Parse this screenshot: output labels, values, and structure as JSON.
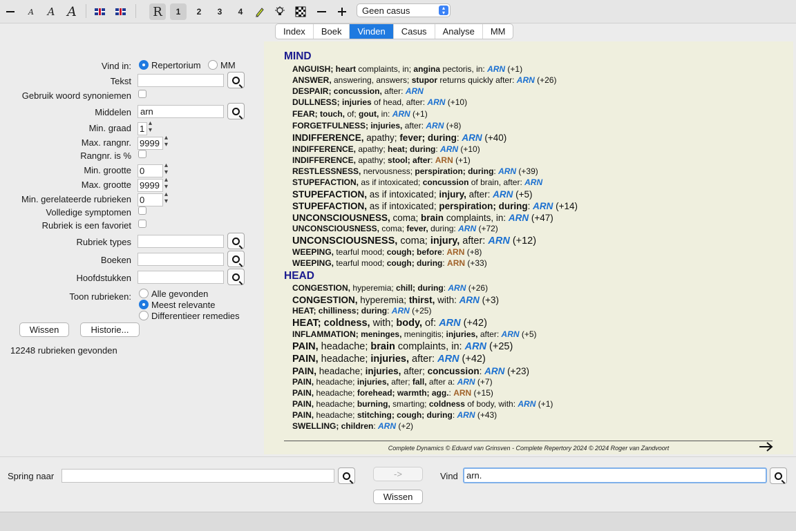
{
  "toolbar": {
    "buttons": [
      {
        "name": "zoom-out-font-icon",
        "glyph": "—"
      },
      {
        "name": "font-small-icon",
        "glyph": "A"
      },
      {
        "name": "font-medium-icon",
        "glyph": "A"
      },
      {
        "name": "font-large-icon",
        "glyph": "A"
      },
      {
        "name": "flag-uk-icon",
        "glyph": ""
      },
      {
        "name": "flag-uk-icon",
        "glyph": ""
      },
      {
        "name": "repertory-icon",
        "glyph": "R"
      },
      {
        "name": "view-1-button",
        "glyph": "1"
      },
      {
        "name": "view-2-button",
        "glyph": "2"
      },
      {
        "name": "view-3-button",
        "glyph": "3"
      },
      {
        "name": "view-4-button",
        "glyph": "4"
      },
      {
        "name": "highlighter-icon",
        "glyph": "✎"
      },
      {
        "name": "lightbulb-icon",
        "glyph": "💡"
      },
      {
        "name": "grid-icon",
        "glyph": "▦"
      },
      {
        "name": "minus-icon",
        "glyph": "−"
      },
      {
        "name": "plus-icon",
        "glyph": "+"
      }
    ],
    "case_select": "Geen casus"
  },
  "tabs": [
    "Index",
    "Boek",
    "Vinden",
    "Casus",
    "Analyse",
    "MM"
  ],
  "active_tab": "Vinden",
  "form": {
    "vind_in_label": "Vind in:",
    "vind_in_options": [
      "Repertorium",
      "MM"
    ],
    "tekst_label": "Tekst",
    "tekst_value": "",
    "synoniemen_label": "Gebruik woord synoniemen",
    "middelen_label": "Middelen",
    "middelen_value": "arn",
    "min_graad_label": "Min. graad",
    "min_graad_value": "1",
    "max_rangnr_label": "Max. rangnr.",
    "max_rangnr_value": "9999",
    "rangnr_pct_label": "Rangnr. is %",
    "min_grootte_label": "Min. grootte",
    "min_grootte_value": "0",
    "max_grootte_label": "Max. grootte",
    "max_grootte_value": "9999",
    "min_gerel_label": "Min. gerelateerde rubrieken",
    "min_gerel_value": "0",
    "volledige_label": "Volledige symptomen",
    "favoriet_label": "Rubriek is een favoriet",
    "rubriek_types_label": "Rubriek types",
    "boeken_label": "Boeken",
    "hoofdstukken_label": "Hoofdstukken",
    "toon_label": "Toon rubrieken:",
    "toon_options": [
      "Alle gevonden",
      "Meest relevante",
      "Differentieer remedies"
    ],
    "wissen_button": "Wissen",
    "historie_button": "Historie...",
    "result_count": "12248 rubrieken gevonden"
  },
  "results": {
    "chapters": [
      {
        "title": "MIND",
        "rubrics": [
          {
            "size": "s",
            "parts": [
              [
                "b",
                "ANGUISH; "
              ],
              [
                "b",
                "heart"
              ],
              [
                "n",
                " complaints, in; "
              ],
              [
                "b",
                "angina"
              ],
              [
                "n",
                " pectoris, in: "
              ]
            ],
            "rem": "ARN",
            "rem_style": "blue",
            "extra": " (+1)"
          },
          {
            "size": "s",
            "parts": [
              [
                "b",
                "ANSWER, "
              ],
              [
                "n",
                "answering, answers; "
              ],
              [
                "b",
                "stupor"
              ],
              [
                "n",
                " returns quickly after: "
              ]
            ],
            "rem": "ARN",
            "rem_style": "blue",
            "extra": " (+26)"
          },
          {
            "size": "s",
            "parts": [
              [
                "b",
                "DESPAIR; concussion, "
              ],
              [
                "n",
                "after: "
              ]
            ],
            "rem": "ARN",
            "rem_style": "blue",
            "extra": ""
          },
          {
            "size": "s",
            "parts": [
              [
                "b",
                "DULLNESS; injuries "
              ],
              [
                "n",
                "of head, after: "
              ]
            ],
            "rem": "ARN",
            "rem_style": "blue",
            "extra": " (+10)"
          },
          {
            "size": "s",
            "parts": [
              [
                "b",
                "FEAR; touch, "
              ],
              [
                "n",
                "of; "
              ],
              [
                "b",
                "gout, "
              ],
              [
                "n",
                "in: "
              ]
            ],
            "rem": "ARN",
            "rem_style": "blue",
            "extra": " (+1)"
          },
          {
            "size": "s",
            "parts": [
              [
                "b",
                "FORGETFULNESS; injuries, "
              ],
              [
                "n",
                "after: "
              ]
            ],
            "rem": "ARN",
            "rem_style": "blue",
            "extra": " (+8)"
          },
          {
            "size": "l",
            "parts": [
              [
                "b",
                "INDIFFERENCE, "
              ],
              [
                "n",
                "apathy; "
              ],
              [
                "b",
                "fever; during"
              ],
              [
                "n",
                ": "
              ]
            ],
            "rem": "ARN",
            "rem_style": "blue",
            "extra": " (+40)"
          },
          {
            "size": "s",
            "parts": [
              [
                "b",
                "INDIFFERENCE, "
              ],
              [
                "n",
                "apathy; "
              ],
              [
                "b",
                "heat; during"
              ],
              [
                "n",
                ": "
              ]
            ],
            "rem": "ARN",
            "rem_style": "blue",
            "extra": " (+10)"
          },
          {
            "size": "s",
            "parts": [
              [
                "b",
                "INDIFFERENCE, "
              ],
              [
                "n",
                "apathy; "
              ],
              [
                "b",
                "stool; after"
              ],
              [
                "n",
                ": "
              ]
            ],
            "rem": "ARN",
            "rem_style": "brown",
            "extra": " (+1)"
          },
          {
            "size": "s",
            "parts": [
              [
                "b",
                "RESTLESSNESS, "
              ],
              [
                "n",
                "nervousness; "
              ],
              [
                "b",
                "perspiration; during"
              ],
              [
                "n",
                ": "
              ]
            ],
            "rem": "ARN",
            "rem_style": "blue",
            "extra": " (+39)"
          },
          {
            "size": "s",
            "parts": [
              [
                "b",
                "STUPEFACTION, "
              ],
              [
                "n",
                "as if intoxicated; "
              ],
              [
                "b",
                "concussion "
              ],
              [
                "n",
                "of brain, after: "
              ]
            ],
            "rem": "ARN",
            "rem_style": "blue",
            "extra": ""
          },
          {
            "size": "l",
            "parts": [
              [
                "b",
                "STUPEFACTION, "
              ],
              [
                "n",
                "as if intoxicated; "
              ],
              [
                "b",
                "injury, "
              ],
              [
                "n",
                "after: "
              ]
            ],
            "rem": "ARN",
            "rem_style": "blue",
            "extra": " (+5)"
          },
          {
            "size": "l",
            "parts": [
              [
                "b",
                "STUPEFACTION, "
              ],
              [
                "n",
                "as if intoxicated; "
              ],
              [
                "b",
                "perspiration; during"
              ],
              [
                "n",
                ": "
              ]
            ],
            "rem": "ARN",
            "rem_style": "blue",
            "extra": " (+14)"
          },
          {
            "size": "l",
            "parts": [
              [
                "b",
                "UNCONSCIOUSNESS, "
              ],
              [
                "n",
                "coma; "
              ],
              [
                "b",
                "brain "
              ],
              [
                "n",
                "complaints, in: "
              ]
            ],
            "rem": "ARN",
            "rem_style": "blue",
            "extra": " (+47)"
          },
          {
            "size": "s",
            "parts": [
              [
                "b",
                "UNCONSCIOUSNESS, "
              ],
              [
                "n",
                "coma; "
              ],
              [
                "b",
                "fever, "
              ],
              [
                "n",
                "during: "
              ]
            ],
            "rem": "ARN",
            "rem_style": "blue",
            "extra": " (+72)"
          },
          {
            "size": "xl",
            "parts": [
              [
                "b",
                "UNCONSCIOUSNESS, "
              ],
              [
                "n",
                "coma; "
              ],
              [
                "b",
                "injury, "
              ],
              [
                "n",
                "after: "
              ]
            ],
            "rem": "ARN",
            "rem_style": "blue",
            "extra": " (+12)"
          },
          {
            "size": "s",
            "parts": [
              [
                "b",
                "WEEPING, "
              ],
              [
                "n",
                "tearful mood; "
              ],
              [
                "b",
                "cough; before"
              ],
              [
                "n",
                ": "
              ]
            ],
            "rem": "ARN",
            "rem_style": "brown",
            "extra": " (+8)"
          },
          {
            "size": "s",
            "parts": [
              [
                "b",
                "WEEPING, "
              ],
              [
                "n",
                "tearful mood; "
              ],
              [
                "b",
                "cough; during"
              ],
              [
                "n",
                ": "
              ]
            ],
            "rem": "ARN",
            "rem_style": "brown",
            "extra": " (+33)"
          }
        ]
      },
      {
        "title": "HEAD",
        "rubrics": [
          {
            "size": "s",
            "parts": [
              [
                "b",
                "CONGESTION, "
              ],
              [
                "n",
                "hyperemia; "
              ],
              [
                "b",
                "chill; during"
              ],
              [
                "n",
                ": "
              ]
            ],
            "rem": "ARN",
            "rem_style": "blue",
            "extra": " (+26)"
          },
          {
            "size": "l",
            "parts": [
              [
                "b",
                "CONGESTION, "
              ],
              [
                "n",
                "hyperemia; "
              ],
              [
                "b",
                "thirst, "
              ],
              [
                "n",
                "with: "
              ]
            ],
            "rem": "ARN",
            "rem_style": "blue",
            "extra": " (+3)"
          },
          {
            "size": "s",
            "parts": [
              [
                "b",
                "HEAT; chilliness; during"
              ],
              [
                "n",
                ": "
              ]
            ],
            "rem": "ARN",
            "rem_style": "blue",
            "extra": " (+25)"
          },
          {
            "size": "xl",
            "parts": [
              [
                "b",
                "HEAT; coldness, "
              ],
              [
                "n",
                "with; "
              ],
              [
                "b",
                "body, "
              ],
              [
                "n",
                "of: "
              ]
            ],
            "rem": "ARN",
            "rem_style": "blue",
            "extra": " (+42)"
          },
          {
            "size": "s",
            "parts": [
              [
                "b",
                "INFLAMMATION; meninges, "
              ],
              [
                "n",
                "meningitis; "
              ],
              [
                "b",
                "injuries, "
              ],
              [
                "n",
                "after: "
              ]
            ],
            "rem": "ARN",
            "rem_style": "blue",
            "extra": " (+5)"
          },
          {
            "size": "xl",
            "parts": [
              [
                "b",
                "PAIN, "
              ],
              [
                "n",
                "headache; "
              ],
              [
                "b",
                "brain "
              ],
              [
                "n",
                "complaints, in: "
              ]
            ],
            "rem": "ARN",
            "rem_style": "blue",
            "extra": " (+25)"
          },
          {
            "size": "xl",
            "parts": [
              [
                "b",
                "PAIN, "
              ],
              [
                "n",
                "headache; "
              ],
              [
                "b",
                "injuries, "
              ],
              [
                "n",
                "after: "
              ]
            ],
            "rem": "ARN",
            "rem_style": "blue",
            "extra": " (+42)"
          },
          {
            "size": "l",
            "parts": [
              [
                "b",
                "PAIN, "
              ],
              [
                "n",
                "headache; "
              ],
              [
                "b",
                "injuries, "
              ],
              [
                "n",
                "after; "
              ],
              [
                "b",
                "concussion"
              ],
              [
                "n",
                ": "
              ]
            ],
            "rem": "ARN",
            "rem_style": "blue",
            "extra": " (+23)"
          },
          {
            "size": "s",
            "parts": [
              [
                "b",
                "PAIN, "
              ],
              [
                "n",
                "headache; "
              ],
              [
                "b",
                "injuries, "
              ],
              [
                "n",
                "after; "
              ],
              [
                "b",
                "fall, "
              ],
              [
                "n",
                "after a: "
              ]
            ],
            "rem": "ARN",
            "rem_style": "blue",
            "extra": " (+7)"
          },
          {
            "size": "s",
            "parts": [
              [
                "b",
                "PAIN, "
              ],
              [
                "n",
                "headache; "
              ],
              [
                "b",
                "forehead; warmth; agg."
              ],
              [
                "n",
                ": "
              ]
            ],
            "rem": "ARN",
            "rem_style": "brown",
            "extra": " (+15)"
          },
          {
            "size": "s",
            "parts": [
              [
                "b",
                "PAIN, "
              ],
              [
                "n",
                "headache; "
              ],
              [
                "b",
                "burning, "
              ],
              [
                "n",
                "smarting; "
              ],
              [
                "b",
                "coldness "
              ],
              [
                "n",
                "of body, with: "
              ]
            ],
            "rem": "ARN",
            "rem_style": "blue",
            "extra": " (+1)"
          },
          {
            "size": "s",
            "parts": [
              [
                "b",
                "PAIN, "
              ],
              [
                "n",
                "headache; "
              ],
              [
                "b",
                "stitching; cough; during"
              ],
              [
                "n",
                ": "
              ]
            ],
            "rem": "ARN",
            "rem_style": "blue",
            "extra": " (+43)"
          },
          {
            "size": "s",
            "parts": [
              [
                "b",
                "SWELLING; children"
              ],
              [
                "n",
                ": "
              ]
            ],
            "rem": "ARN",
            "rem_style": "blue",
            "extra": " (+2)"
          }
        ]
      }
    ],
    "footer": "Complete Dynamics © Eduard van Grinsven   -   Complete Repertory 2024 © 2024 Roger van Zandvoort"
  },
  "bottom": {
    "spring_label": "Spring naar",
    "spring_value": "",
    "arrow_button": "->",
    "vind_label": "Vind",
    "vind_value": "arn.",
    "wissen_button": "Wissen"
  }
}
